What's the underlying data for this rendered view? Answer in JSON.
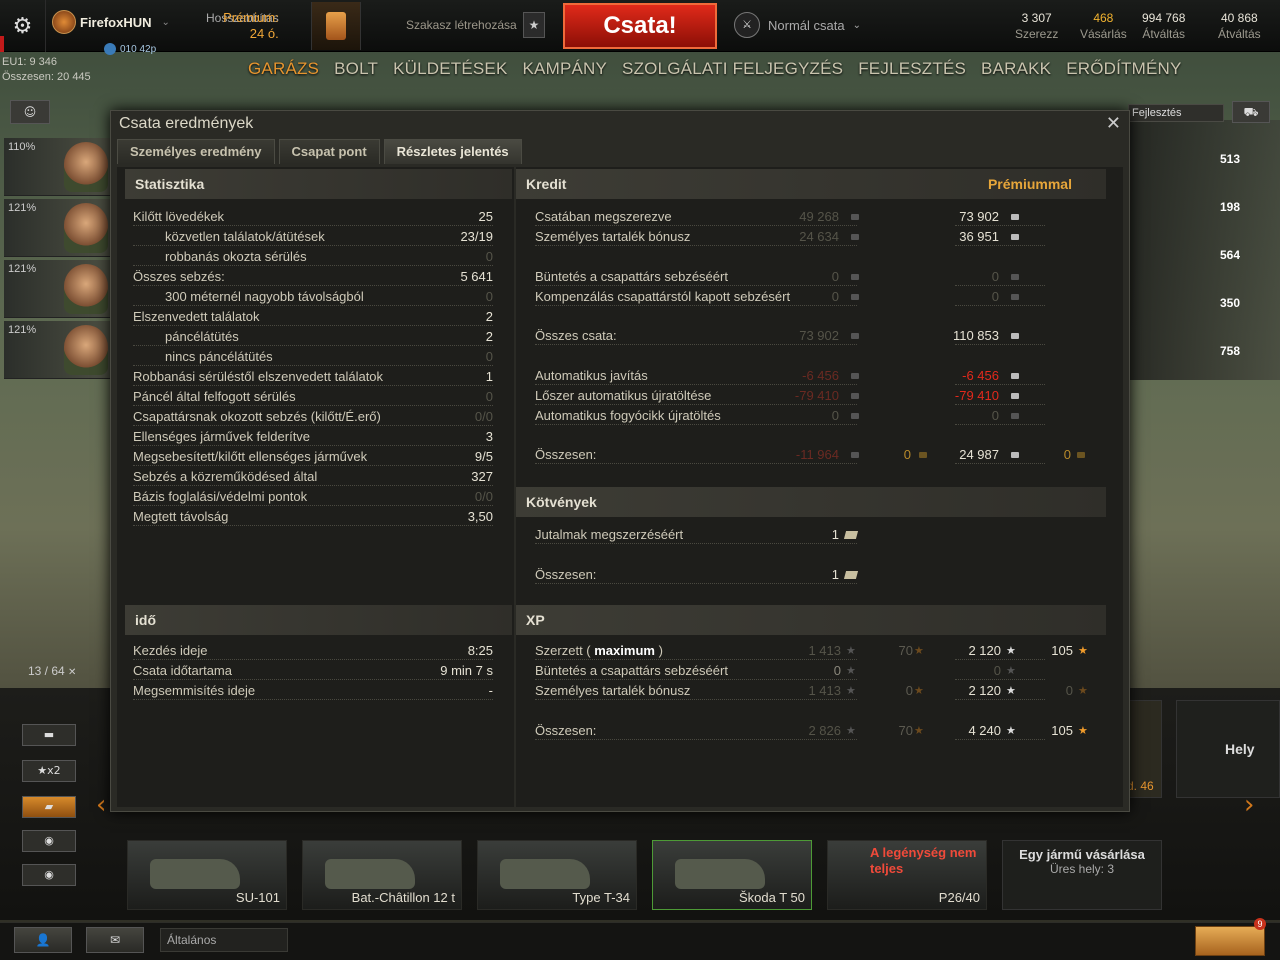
{
  "topbar": {
    "player_name": "FirefoxHUN",
    "clan_tag": "010 42p",
    "premium_line": "Prémium: 24 ó.",
    "premium_extend": "Hosszabbítás",
    "platoon_label": "Szakasz létrehozása",
    "battle_button": "Csata!",
    "battle_mode": "Normál csata",
    "resources": [
      {
        "value": "3 307",
        "label": "Szerezz",
        "icon": "free-xp-icon"
      },
      {
        "value": "468",
        "label": "Vásárlás",
        "icon": "gold-icon"
      },
      {
        "value": "994 768",
        "label": "Átváltás",
        "icon": "credits-icon"
      },
      {
        "value": "40 868",
        "label": "Átváltás",
        "icon": "free-xp-star-icon"
      }
    ],
    "server_line": "EU1: 9 346",
    "total_line": "Összesen: 20 445"
  },
  "nav": [
    "GARÁZS",
    "BOLT",
    "KÜLDETÉSEK",
    "KAMPÁNY",
    "SZOLGÁLATI FELJEGYZÉS",
    "FEJLESZTÉS",
    "BARAKK",
    "ERŐDÍTMÉNY"
  ],
  "crew": [
    "110%",
    "121%",
    "121%",
    "121%"
  ],
  "right_panel": {
    "upgrade_label": "Fejlesztés",
    "stats": [
      "513",
      "198",
      "564",
      "350",
      "758"
    ]
  },
  "carousel": {
    "counter": "13 / 64",
    "tanks": [
      "SU-101",
      "Bat.-Châtillon 12 t",
      "Type T-34",
      "Škoda T 50",
      "P26/40"
    ],
    "crew_warning": "A legénység nem teljes",
    "buy_title": "Egy jármű vásárlása",
    "buy_sub": "Üres hely: 3",
    "right_card": "Hely",
    "right_card2": "d. 46",
    "x2_badge": "x2"
  },
  "bottombar": {
    "chat_channel": "Általános",
    "notif_count": "9"
  },
  "dialog": {
    "title": "Csata eredmények",
    "tabs": [
      "Személyes eredmény",
      "Csapat pont",
      "Részletes jelentés"
    ],
    "stats_header": "Statisztika",
    "stats": [
      {
        "label": "Kilőtt lövedékek",
        "value": "25",
        "indent": false,
        "dim": false
      },
      {
        "label": "közvetlen találatok/átütések",
        "value": "23/19",
        "indent": true,
        "dim": false
      },
      {
        "label": "robbanás okozta sérülés",
        "value": "0",
        "indent": true,
        "dim": true
      },
      {
        "label": "Összes sebzés:",
        "value": "5 641",
        "indent": false,
        "dim": false
      },
      {
        "label": "300 méternél nagyobb távolságból",
        "value": "0",
        "indent": true,
        "dim": true
      },
      {
        "label": "Elszenvedett találatok",
        "value": "2",
        "indent": false,
        "dim": false
      },
      {
        "label": "páncélátütés",
        "value": "2",
        "indent": true,
        "dim": false
      },
      {
        "label": "nincs páncélátütés",
        "value": "0",
        "indent": true,
        "dim": true
      },
      {
        "label": "Robbanási sérüléstől elszenvedett találatok",
        "value": "1",
        "indent": false,
        "dim": false
      },
      {
        "label": "Páncél által felfogott sérülés",
        "value": "0",
        "indent": false,
        "dim": true
      },
      {
        "label": "Csapattársnak okozott sebzés (kilőtt/É.erő)",
        "value": "0/0",
        "indent": false,
        "dim": true
      },
      {
        "label": "Ellenséges járművek felderítve",
        "value": "3",
        "indent": false,
        "dim": false
      },
      {
        "label": "Megsebesített/kilőtt ellenséges járművek",
        "value": "9/5",
        "indent": false,
        "dim": false
      },
      {
        "label": "Sebzés a közreműködésed által",
        "value": "327",
        "indent": false,
        "dim": false
      },
      {
        "label": "Bázis foglalási/védelmi pontok",
        "value": "0/0",
        "indent": false,
        "dim": true
      },
      {
        "label": "Megtett távolság",
        "value": "3,50",
        "indent": false,
        "dim": false
      }
    ],
    "time_header": "idő",
    "time": [
      {
        "label": "Kezdés ideje",
        "value": "8:25"
      },
      {
        "label": "Csata időtartama",
        "value": "9 min 7 s"
      },
      {
        "label": "Megsemmisítés ideje",
        "value": "-"
      }
    ],
    "credit_header": "Kredit",
    "credit_premium": "Prémiummal",
    "credit_rows": [
      {
        "label": "Csatában megszerezve",
        "v1": "49 268",
        "v2": "",
        "v3": "73 902",
        "v4": "",
        "v1c": "dim",
        "v3c": "norm"
      },
      {
        "label": "Személyes tartalék bónusz",
        "v1": "24 634",
        "v2": "",
        "v3": "36 951",
        "v4": "",
        "v1c": "dim",
        "v3c": "norm"
      },
      {
        "label": "Büntetés a csapattárs sebzéséért",
        "v1": "0",
        "v2": "",
        "v3": "0",
        "v4": "",
        "v1c": "dimw",
        "v3c": "dim"
      },
      {
        "label": "Kompenzálás csapattárstól kapott sebzésért",
        "v1": "0",
        "v2": "",
        "v3": "0",
        "v4": "",
        "v1c": "dimw",
        "v3c": "dim"
      },
      {
        "label": "Összes csata:",
        "v1": "73 902",
        "v2": "",
        "v3": "110 853",
        "v4": "",
        "v1c": "dim",
        "v3c": "norm"
      },
      {
        "label": "Automatikus javítás",
        "v1": "-6 456",
        "v2": "",
        "v3": "-6 456",
        "v4": "",
        "v1c": "dimred",
        "v3c": "red"
      },
      {
        "label": "Lőszer automatikus újratöltése",
        "v1": "-79 410",
        "v2": "",
        "v3": "-79 410",
        "v4": "",
        "v1c": "dimred",
        "v3c": "red"
      },
      {
        "label": "Automatikus fogyócikk újratöltés",
        "v1": "0",
        "v2": "",
        "v3": "0",
        "v4": "",
        "v1c": "dimw",
        "v3c": "dim"
      },
      {
        "label": "Összesen:",
        "v1": "-11 964",
        "v2": "0",
        "v3": "24 987",
        "v4": "0",
        "v1c": "dimred",
        "v3c": "norm"
      }
    ],
    "bonds_header": "Kötvények",
    "bonds": [
      {
        "label": "Jutalmak megszerzéséért",
        "value": "1"
      },
      {
        "label": "Összesen:",
        "value": "1"
      }
    ],
    "xp_header": "XP",
    "xp_rows": [
      {
        "label": "Szerzett (",
        "label_bold": "maximum",
        "label_end": ")",
        "v1": "1 413",
        "v2": "70",
        "v3": "2 120",
        "v4": "105"
      },
      {
        "label": "Büntetés a csapattárs sebzéséért",
        "label_bold": "",
        "label_end": "",
        "v1": "0",
        "v2": "",
        "v3": "0",
        "v4": ""
      },
      {
        "label": "Személyes tartalék bónusz",
        "label_bold": "",
        "label_end": "",
        "v1": "1 413",
        "v2": "0",
        "v3": "2 120",
        "v4": "0"
      },
      {
        "label": "Összesen:",
        "label_bold": "",
        "label_end": "",
        "v1": "2 826",
        "v2": "70",
        "v3": "4 240",
        "v4": "105"
      }
    ]
  },
  "colors": {
    "accent": "#e7952f",
    "battle_red": "#c21a0e",
    "negative": "#e2291c",
    "gold": "#f2b32f"
  }
}
